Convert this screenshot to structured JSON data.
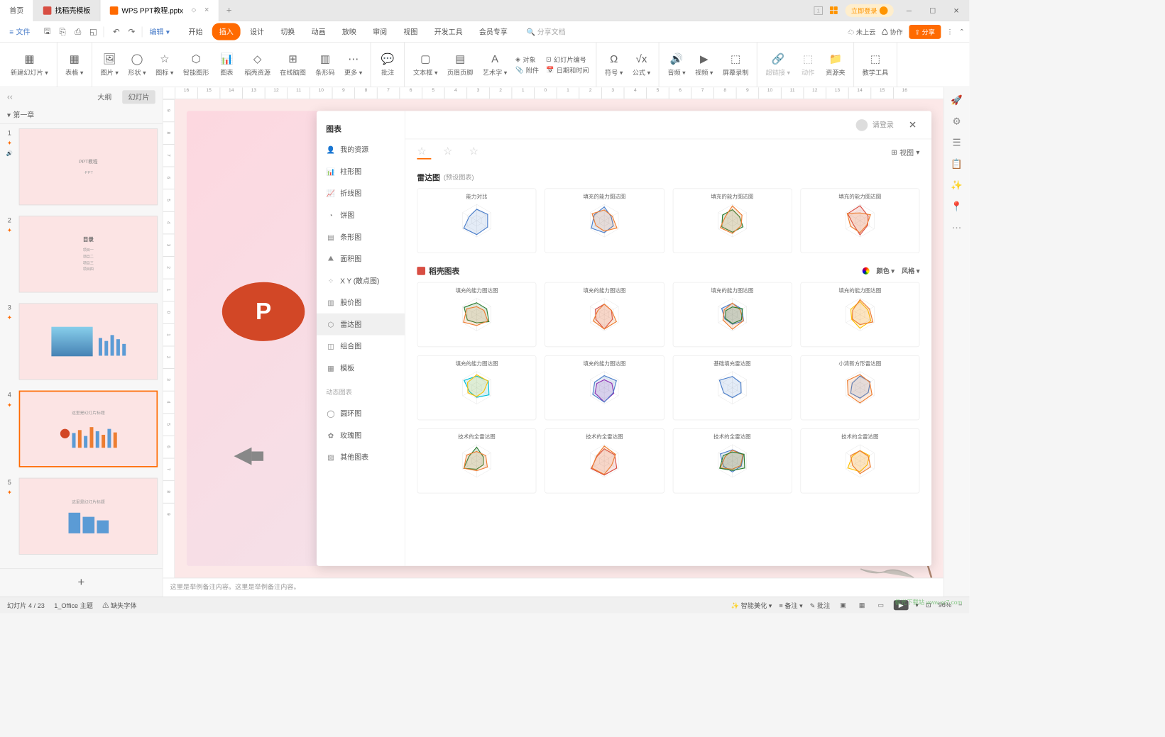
{
  "titlebar": {
    "home_tab": "首页",
    "docker_tab": "找稻壳模板",
    "file_tab": "WPS PPT教程.pptx",
    "login": "立即登录"
  },
  "menubar": {
    "file": "文件",
    "edit": "编辑",
    "tabs": [
      "开始",
      "插入",
      "设计",
      "切换",
      "动画",
      "放映",
      "审阅",
      "视图",
      "开发工具",
      "会员专享"
    ],
    "active_tab_index": 1,
    "search_placeholder": "分享文档",
    "cloud": "未上云",
    "coop": "协作",
    "share": "分享"
  },
  "ribbon": {
    "items": [
      {
        "label": "新建幻灯片",
        "dropdown": true
      },
      {
        "label": "表格",
        "dropdown": true
      },
      {
        "label": "图片",
        "dropdown": true
      },
      {
        "label": "形状",
        "dropdown": true
      },
      {
        "label": "图标",
        "dropdown": true
      },
      {
        "label": "智能图形"
      },
      {
        "label": "图表"
      },
      {
        "label": "稻壳资源"
      },
      {
        "label": "在线脑图"
      },
      {
        "label": "条形码"
      },
      {
        "label": "更多",
        "dropdown": true
      },
      {
        "label": "批注"
      },
      {
        "label": "文本框",
        "dropdown": true
      },
      {
        "label": "页眉页脚"
      },
      {
        "label": "艺术字",
        "dropdown": true
      },
      {
        "label": "符号",
        "dropdown": true
      },
      {
        "label": "公式",
        "dropdown": true
      },
      {
        "label": "音频",
        "dropdown": true
      },
      {
        "label": "视频",
        "dropdown": true
      },
      {
        "label": "屏幕录制"
      },
      {
        "label": "超链接",
        "dropdown": true,
        "disabled": true
      },
      {
        "label": "动作",
        "disabled": true
      },
      {
        "label": "资源夹"
      },
      {
        "label": "教学工具"
      }
    ],
    "side_items": {
      "object": "对象",
      "attachment": "附件",
      "slide_num": "幻灯片编号",
      "datetime": "日期和时间"
    }
  },
  "left_panel": {
    "outline_tab": "大纲",
    "slides_tab": "幻灯片",
    "chapter": "第一章",
    "thumbs": [
      {
        "num": "1",
        "title": "PPT教程",
        "sub": "·PPT"
      },
      {
        "num": "2",
        "title": "目录"
      },
      {
        "num": "3",
        "title": ""
      },
      {
        "num": "4",
        "title": "这里是幻灯片标题",
        "selected": true
      },
      {
        "num": "5",
        "title": "这里是幻灯片标题"
      }
    ]
  },
  "ruler_h": [
    "16",
    "15",
    "14",
    "13",
    "12",
    "11",
    "10",
    "9",
    "8",
    "7",
    "6",
    "5",
    "4",
    "3",
    "2",
    "1",
    "0",
    "1",
    "2",
    "3",
    "4",
    "5",
    "6",
    "7",
    "8",
    "9",
    "10",
    "11",
    "12",
    "13",
    "14",
    "15",
    "16"
  ],
  "ruler_v": [
    "9",
    "8",
    "7",
    "6",
    "5",
    "4",
    "3",
    "2",
    "1",
    "0",
    "1",
    "2",
    "3",
    "4",
    "5",
    "6",
    "7",
    "8",
    "9"
  ],
  "chart_dialog": {
    "title": "图表",
    "login_text": "请登录",
    "categories": [
      {
        "label": "我的资源",
        "icon": "user"
      },
      {
        "label": "柱形图",
        "icon": "bar"
      },
      {
        "label": "折线图",
        "icon": "line"
      },
      {
        "label": "饼图",
        "icon": "pie"
      },
      {
        "label": "条形图",
        "icon": "hbar"
      },
      {
        "label": "面积图",
        "icon": "area"
      },
      {
        "label": "X Y (散点图)",
        "icon": "scatter"
      },
      {
        "label": "股价图",
        "icon": "stock"
      },
      {
        "label": "雷达图",
        "icon": "radar",
        "selected": true
      },
      {
        "label": "组合图",
        "icon": "combo"
      },
      {
        "label": "模板",
        "icon": "template"
      }
    ],
    "dynamic_header": "动态图表",
    "dynamic_cats": [
      {
        "label": "圆环图",
        "icon": "donut"
      },
      {
        "label": "玫瑰图",
        "icon": "rose"
      },
      {
        "label": "其他图表",
        "icon": "other"
      }
    ],
    "view_label": "视图",
    "section1_title": "雷达图",
    "section1_sub": "(预设图表)",
    "preset_charts": [
      {
        "title": "能力对比"
      },
      {
        "title": "填充的能力图达图"
      },
      {
        "title": "填充的能力图达图"
      },
      {
        "title": "填充的能力图达图"
      }
    ],
    "section2_title": "稻壳图表",
    "color_filter": "颜色",
    "style_filter": "风格",
    "docker_charts": [
      {
        "title": "填充的能力图达图"
      },
      {
        "title": "填充的能力图达图"
      },
      {
        "title": "填充的能力图达图"
      },
      {
        "title": "填充的能力图达图"
      },
      {
        "title": "填充的能力图达图"
      },
      {
        "title": "填充的能力图达图"
      },
      {
        "title": "基础填充雷达图"
      },
      {
        "title": "小清新方形雷达图"
      },
      {
        "title": "技术的全雷达图"
      },
      {
        "title": "技术的全雷达图"
      },
      {
        "title": "技术的全雷达图"
      },
      {
        "title": "技术的全雷达图"
      }
    ]
  },
  "notes": "这里是举例备注内容。这里是举例备注内容。",
  "statusbar": {
    "slide_pos": "幻灯片 4 / 23",
    "theme": "1_Office 主题",
    "missing_fonts": "缺失字体",
    "beautify": "智能美化",
    "notes_btn": "备注",
    "annotate": "批注",
    "zoom": "96%"
  },
  "watermark": "极光下载站 www.xz7.com",
  "page_num_badge": "4"
}
